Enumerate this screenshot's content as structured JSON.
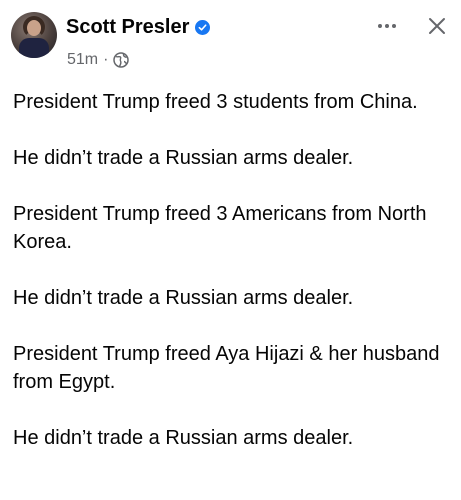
{
  "post": {
    "author": "Scott Presler",
    "timestamp": "51m",
    "separator": "·",
    "privacy_icon": "globe-icon",
    "verified_icon": "verified-badge-icon",
    "more_icon": "more-horizontal-icon",
    "close_icon": "close-icon",
    "paragraphs": [
      "President Trump freed 3 students from China.",
      "He didn’t trade a Russian arms dealer.",
      "President Trump freed 3 Americans from North Korea.",
      "He didn’t trade a Russian arms dealer.",
      "President Trump freed Aya Hijazi & her husband from Egypt.",
      "He didn’t trade a Russian arms dealer."
    ]
  },
  "colors": {
    "verified": "#1877f2",
    "meta_text": "#65676b",
    "body_text": "#050505"
  }
}
